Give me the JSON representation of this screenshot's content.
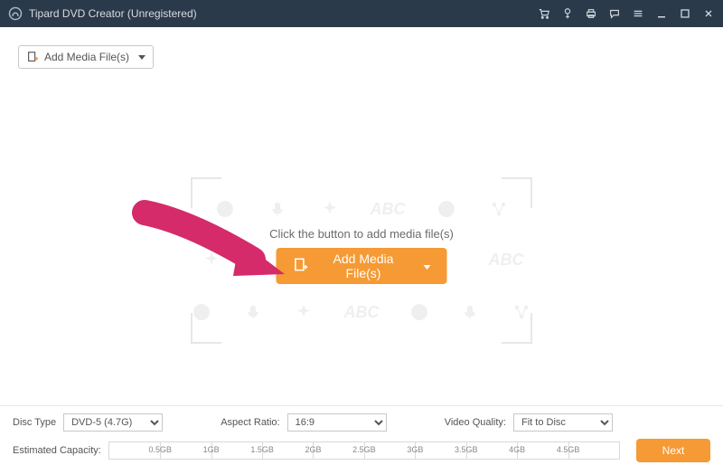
{
  "titlebar": {
    "app_title": "Tipard DVD Creator (Unregistered)"
  },
  "toolbar": {
    "add_small_label": "Add Media File(s)"
  },
  "center": {
    "prompt": "Click the button to add media file(s)",
    "add_big_label": "Add Media File(s)",
    "bg_abc": "ABC"
  },
  "footer": {
    "disc_type_label": "Disc Type",
    "disc_type_value": "DVD-5 (4.7G)",
    "aspect_label": "Aspect Ratio:",
    "aspect_value": "16:9",
    "quality_label": "Video Quality:",
    "quality_value": "Fit to Disc",
    "capacity_label": "Estimated Capacity:",
    "ticks": [
      "0.5GB",
      "1GB",
      "1.5GB",
      "2GB",
      "2.5GB",
      "3GB",
      "3.5GB",
      "4GB",
      "4.5GB"
    ],
    "next_label": "Next"
  }
}
